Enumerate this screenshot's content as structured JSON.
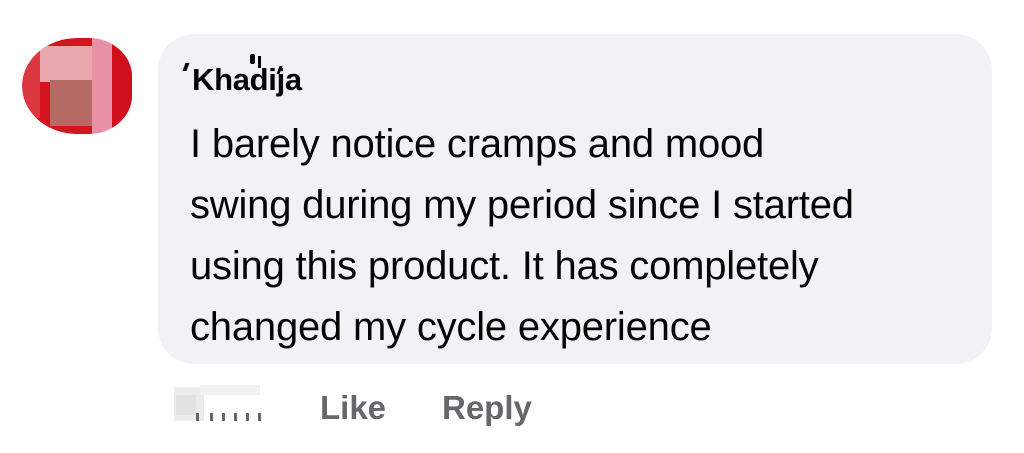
{
  "comment": {
    "author": "Khadija",
    "lines": [
      "I barely notice cramps and mood",
      "swing during my period since I started",
      "using this product. It has completely",
      "changed my cycle experience"
    ]
  },
  "actions": {
    "like_label": "Like",
    "reply_label": "Reply"
  },
  "colors": {
    "bubble_bg": "#f0f2f5",
    "text": "#050505",
    "secondary_text": "#65676b",
    "avatar_red": "#d4141e",
    "avatar_pink": "#e8a7ad"
  }
}
